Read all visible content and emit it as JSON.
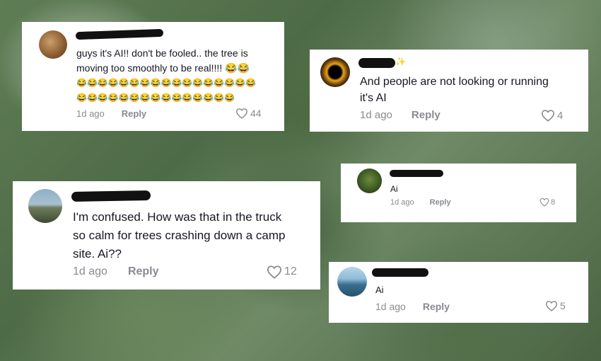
{
  "comments": [
    {
      "text_lines": [
        "guys it's AI!! don't be fooled.. the tree is",
        "moving too smoothly to be real!!!! 😂😂",
        "😂😂😂😂😂😂😂😂😂😂😂😂😂😂😂😂😂",
        "😂😂😂😂😂😂😂😂😂😂😂😂😂😂😂"
      ],
      "time": "1d ago",
      "reply": "Reply",
      "likes": "44"
    },
    {
      "name_spark": "✨",
      "text_lines": [
        "And people are not looking or running",
        "it's AI"
      ],
      "time": "1d ago",
      "reply": "Reply",
      "likes": "4"
    },
    {
      "text_lines": [
        "I'm confused. How was that in the truck",
        "so calm for trees crashing down a camp",
        "site. Ai??"
      ],
      "time": "1d ago",
      "reply": "Reply",
      "likes": "12"
    },
    {
      "text_lines": [
        "Ai"
      ],
      "time": "1d ago",
      "reply": "Reply",
      "likes": "8"
    },
    {
      "text_lines": [
        "Ai"
      ],
      "time": "1d ago",
      "reply": "Reply",
      "likes": "5"
    }
  ]
}
